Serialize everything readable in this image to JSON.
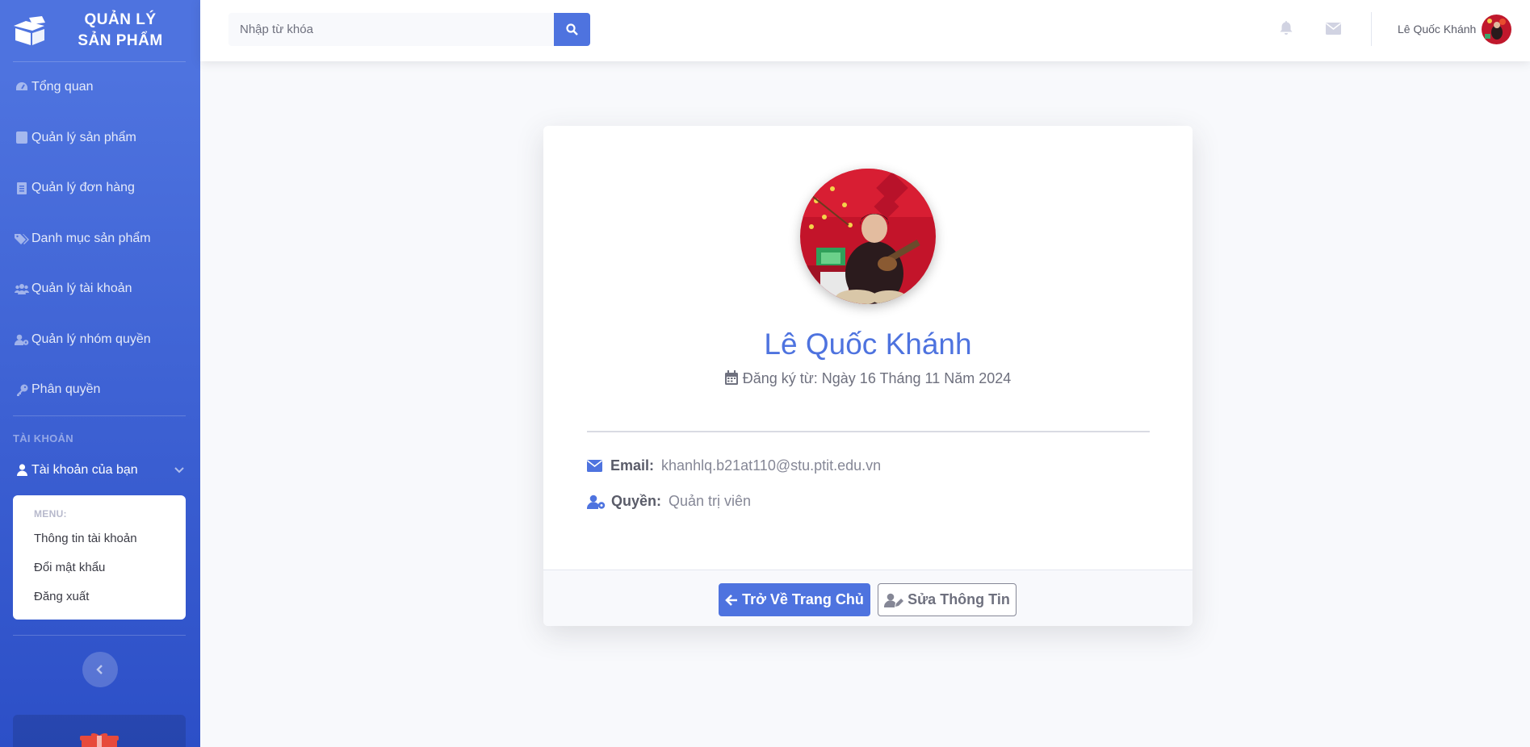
{
  "brand": {
    "line1": "QUẢN LÝ",
    "line2": "SẢN PHẨM",
    "logo_icon": "box-open-icon"
  },
  "sidebar": {
    "items": [
      {
        "label": "Tổng quan",
        "icon": "tachometer-icon"
      },
      {
        "label": "Quản lý sản phẩm",
        "icon": "box-icon"
      },
      {
        "label": "Quản lý đơn hàng",
        "icon": "receipt-icon"
      },
      {
        "label": "Danh mục sản phẩm",
        "icon": "tags-icon"
      },
      {
        "label": "Quản lý tài khoản",
        "icon": "users-icon"
      },
      {
        "label": "Quản lý nhóm quyền",
        "icon": "user-cog-icon"
      },
      {
        "label": "Phân quyền",
        "icon": "key-icon"
      }
    ],
    "heading": "TÀI KHOẢN",
    "account": {
      "label": "Tài khoản của bạn",
      "menu_header": "MENU:",
      "menu": [
        "Thông tin tài khoản",
        "Đổi mật khẩu",
        "Đăng xuất"
      ]
    }
  },
  "topbar": {
    "search_placeholder": "Nhập từ khóa",
    "user_name": "Lê Quốc Khánh"
  },
  "profile": {
    "name": "Lê Quốc Khánh",
    "registered": "Đăng ký từ: Ngày 16 Tháng 11 Năm 2024",
    "email_label": "Email:",
    "email": "khanhlq.b21at110@stu.ptit.edu.vn",
    "role_label": "Quyền:",
    "role": "Quản trị viên",
    "back_button": "Trở Về Trang Chủ",
    "edit_button": "Sửa Thông Tin"
  },
  "colors": {
    "primary": "#4e73df",
    "sidebar_dark": "#2c4fc7",
    "page_bg": "#f8f9fc"
  }
}
